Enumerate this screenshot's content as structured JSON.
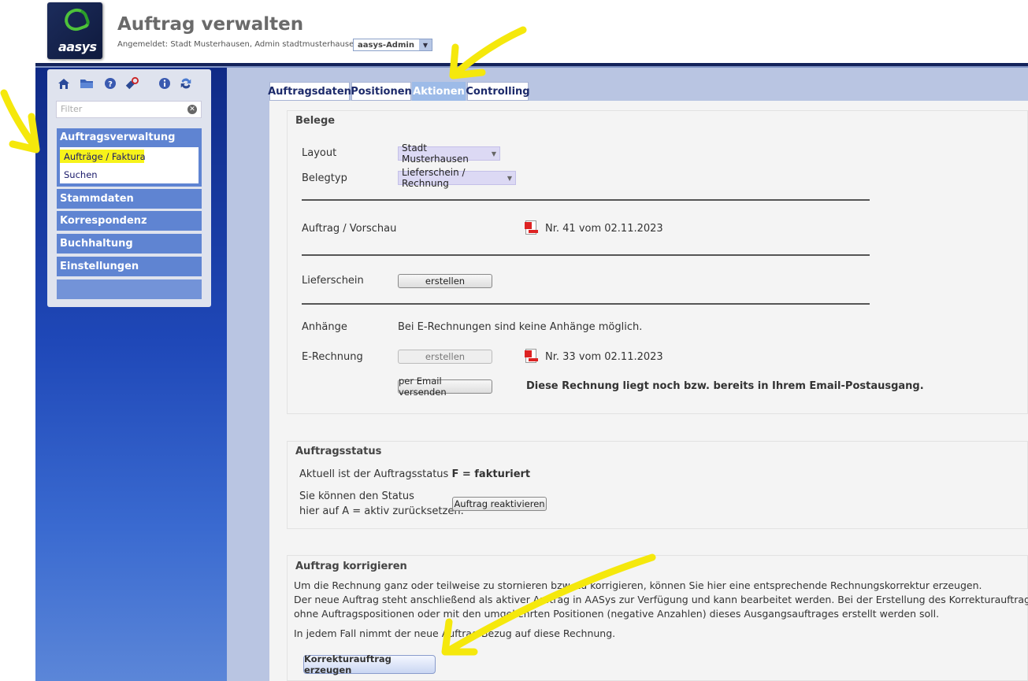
{
  "header": {
    "logo_text": "aasys",
    "title": "Auftrag verwalten",
    "login_line": "Angemeldet: Stadt Musterhausen, Admin stadtmusterhausen",
    "role_value": "aasys-Admin"
  },
  "sidebar": {
    "filter_placeholder": "Filter",
    "toolbar_icons": [
      "home-icon",
      "folder-icon",
      "help-icon",
      "pin-icon",
      "info-icon",
      "refresh-icon"
    ],
    "groups": [
      {
        "label": "Auftragsverwaltung",
        "items": [
          "Aufträge / Faktura",
          "Suchen"
        ]
      },
      {
        "label": "Stammdaten"
      },
      {
        "label": "Korrespondenz"
      },
      {
        "label": "Buchhaltung"
      },
      {
        "label": "Einstellungen"
      }
    ]
  },
  "tabs": [
    "Auftragsdaten",
    "Positionen",
    "Aktionen",
    "Controlling"
  ],
  "active_tab": "Aktionen",
  "belege": {
    "title": "Belege",
    "layout_label": "Layout",
    "layout_value": "Stadt Musterhausen",
    "belegtyp_label": "Belegtyp",
    "belegtyp_value": "Lieferschein / Rechnung",
    "vorschau_label": "Auftrag / Vorschau",
    "vorschau_doc": "Nr. 41 vom 02.11.2023",
    "lieferschein_label": "Lieferschein",
    "lieferschein_btn": "erstellen",
    "anhaenge_label": "Anhänge",
    "anhaenge_text": "Bei E-Rechnungen sind keine Anhänge möglich.",
    "erechnung_label": "E-Rechnung",
    "erechnung_btn": "erstellen",
    "erechnung_doc": "Nr. 33 vom 02.11.2023",
    "email_btn": "per Email versenden",
    "email_note": "Diese Rechnung liegt noch bzw. bereits in Ihrem Email-Postausgang."
  },
  "status": {
    "title": "Auftragsstatus",
    "current_prefix": "Aktuell ist der Auftragsstatus ",
    "current_value": "F = fakturiert",
    "reset_line1": "Sie können den Status",
    "reset_line2": "hier auf A = aktiv zurücksetzen.",
    "reactivate_btn": "Auftrag reaktivieren"
  },
  "korrektur": {
    "title": "Auftrag korrigieren",
    "line1": "Um die Rechnung ganz oder teilweise zu stornieren bzw. zu korrigieren, können Sie hier eine entsprechende Rechnungskorrektur erzeugen.",
    "line2": "Der neue Auftrag steht anschließend als aktiver Auftrag in AASys zur Verfügung und kann bearbeitet werden. Bei der Erstellung des Korrekturauftrages könn",
    "line3": "ohne Auftragspositionen oder mit den umgekehrten Positionen (negative Anzahlen) dieses Ausgangsauftrages erstellt werden soll.",
    "line4": "In jedem Fall nimmt der neue Auftrag Bezug auf diese Rechnung.",
    "button": "Korrekturauftrag erzeugen"
  },
  "colors": {
    "nav_blue": "#5f84d2",
    "active_tab": "#9dbbe8",
    "highlight": "#f7f31a",
    "annotation_arrow": "#f5e80c"
  }
}
